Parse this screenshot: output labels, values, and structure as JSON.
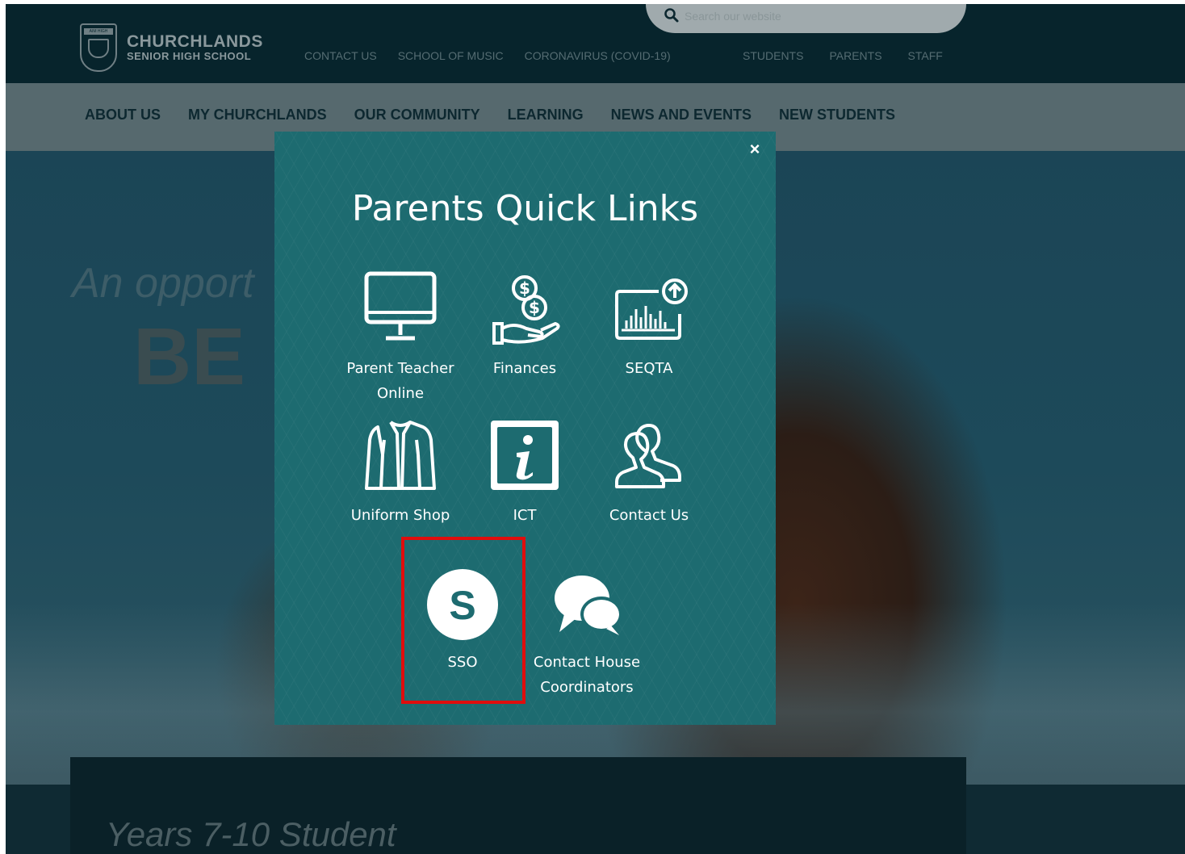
{
  "header": {
    "logo_main": "CHURCHLANDS",
    "logo_sub": "SENIOR HIGH SCHOOL",
    "crest_text": "AIM HIGH",
    "search_placeholder": "Search our website",
    "left_links": [
      "CONTACT US",
      "SCHOOL OF MUSIC",
      "CORONAVIRUS (COVID-19)"
    ],
    "right_links": [
      "STUDENTS",
      "PARENTS",
      "STAFF"
    ]
  },
  "nav": {
    "items": [
      "ABOUT US",
      "MY CHURCHLANDS",
      "OUR COMMUNITY",
      "LEARNING",
      "NEWS AND EVENTS",
      "NEW STUDENTS"
    ]
  },
  "hero": {
    "tagline": "An opport",
    "big": "BE"
  },
  "lower": {
    "title": "Years 7-10 Student"
  },
  "modal": {
    "title": "Parents Quick Links",
    "close_label": "×",
    "tiles": [
      {
        "label_1": "Parent Teacher",
        "label_2": "Online",
        "icon": "monitor-icon"
      },
      {
        "label_1": "Finances",
        "icon": "finances-icon"
      },
      {
        "label_1": "SEQTA",
        "icon": "seqta-chart-icon"
      },
      {
        "label_1": "Uniform Shop",
        "icon": "jacket-icon"
      },
      {
        "label_1": "ICT",
        "icon": "info-icon"
      },
      {
        "label_1": "Contact Us",
        "icon": "people-icon"
      },
      {
        "label_1": "SSO",
        "icon": "sso-icon",
        "icon_letter": "S"
      },
      {
        "label_1": "Contact House",
        "label_2": "Coordinators",
        "icon": "chat-bubbles-icon"
      }
    ]
  },
  "colors": {
    "modal_bg": "#1d6b70",
    "highlight": "#e00d0d",
    "topbar": "#07242c",
    "nav_bg": "#56696e"
  }
}
